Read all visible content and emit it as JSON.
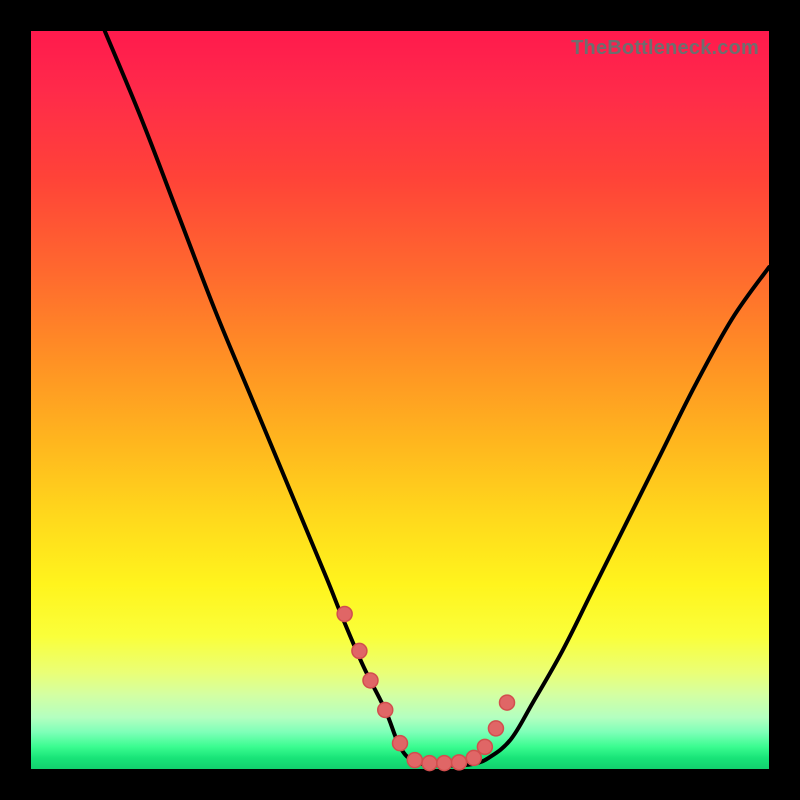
{
  "watermark": "TheBottleneck.com",
  "colors": {
    "curve": "#000000",
    "marker_fill": "#e06666",
    "marker_stroke": "#d24e4e"
  },
  "chart_data": {
    "type": "line",
    "title": "",
    "xlabel": "",
    "ylabel": "",
    "xlim": [
      0,
      100
    ],
    "ylim": [
      0,
      100
    ],
    "series": [
      {
        "name": "bottleneck-curve",
        "x": [
          10,
          15,
          20,
          25,
          30,
          35,
          40,
          42,
          45,
          48,
          50,
          52,
          55,
          58,
          60,
          62,
          65,
          68,
          72,
          76,
          80,
          85,
          90,
          95,
          100
        ],
        "values": [
          100,
          88,
          75,
          62,
          50,
          38,
          26,
          21,
          14,
          8,
          3,
          1,
          0.5,
          0.5,
          0.7,
          1.5,
          4,
          9,
          16,
          24,
          32,
          42,
          52,
          61,
          68
        ]
      }
    ],
    "markers": {
      "name": "highlight-points-near-min",
      "x": [
        42.5,
        44.5,
        46,
        48,
        50,
        52,
        54,
        56,
        58,
        60,
        61.5,
        63,
        64.5
      ],
      "values": [
        21,
        16,
        12,
        8,
        3.5,
        1.2,
        0.8,
        0.8,
        0.9,
        1.5,
        3,
        5.5,
        9
      ]
    }
  }
}
